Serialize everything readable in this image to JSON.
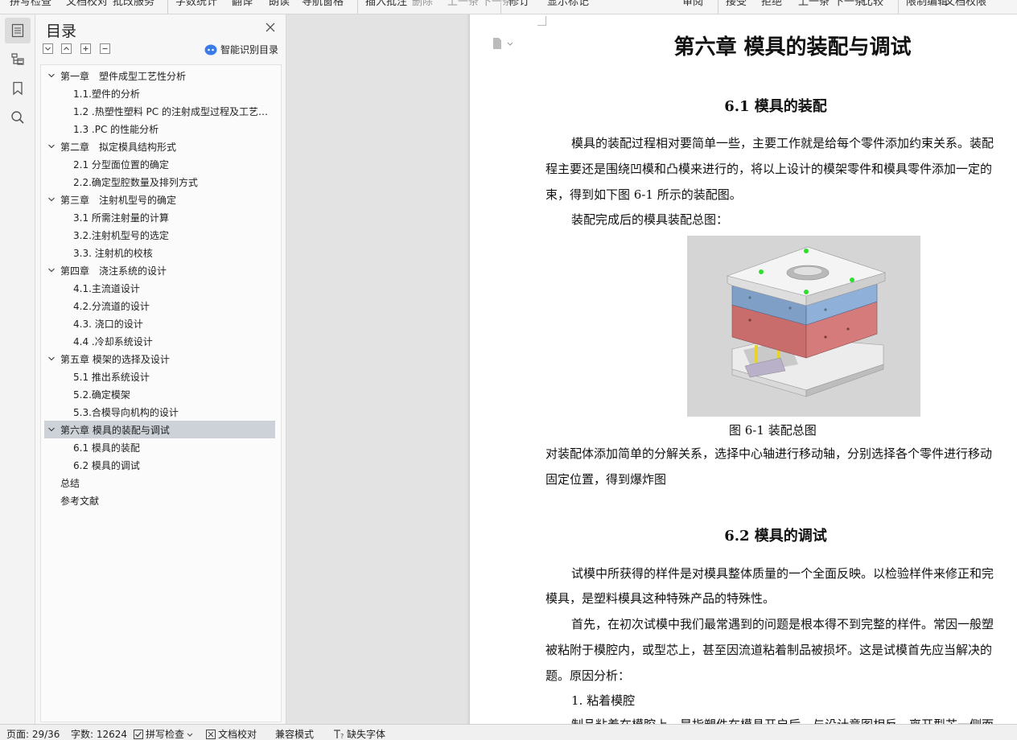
{
  "ribbon": {
    "items": [
      "拼写检查",
      "文档校对",
      "批改服务",
      "字数统计",
      "翻译",
      "朗读",
      "导航窗格",
      "插入批注",
      "删除",
      "上一条",
      "下一条",
      "修订",
      "显示标记",
      "审阅",
      "接受",
      "拒绝",
      "上一条",
      "下一条",
      "比较",
      "限制编辑",
      "文档权限"
    ]
  },
  "toc": {
    "title": "目录",
    "smart_label": "智能识别目录",
    "items": [
      {
        "level": 1,
        "text": "第一章　塑件成型工艺性分析",
        "expanded": true
      },
      {
        "level": 2,
        "text": "1.1.塑件的分析"
      },
      {
        "level": 2,
        "text": "1.2 .热塑性塑料 PC 的注射成型过程及工艺参数"
      },
      {
        "level": 2,
        "text": "1.3 .PC 的性能分析"
      },
      {
        "level": 1,
        "text": "第二章　拟定模具结构形式",
        "expanded": true
      },
      {
        "level": 2,
        "text": "2.1 分型面位置的确定"
      },
      {
        "level": 2,
        "text": "2.2.确定型腔数量及排列方式"
      },
      {
        "level": 1,
        "text": "第三章　注射机型号的确定",
        "expanded": true
      },
      {
        "level": 2,
        "text": "3.1 所需注射量的计算"
      },
      {
        "level": 2,
        "text": "3.2.注射机型号的选定"
      },
      {
        "level": 2,
        "text": "3.3.  注射机的校核"
      },
      {
        "level": 1,
        "text": "第四章　浇注系统的设计",
        "expanded": true
      },
      {
        "level": 2,
        "text": "4.1.主流道设计"
      },
      {
        "level": 2,
        "text": "4.2.分流道的设计"
      },
      {
        "level": 2,
        "text": "4.3.  浇口的设计"
      },
      {
        "level": 2,
        "text": "4.4 .冷却系统设计"
      },
      {
        "level": 1,
        "text": "第五章  模架的选择及设计",
        "expanded": true
      },
      {
        "level": 2,
        "text": "5.1  推出系统设计"
      },
      {
        "level": 2,
        "text": "5.2.确定模架"
      },
      {
        "level": 2,
        "text": "5.3.合模导向机构的设计"
      },
      {
        "level": 1,
        "text": "第六章  模具的装配与调试",
        "expanded": true,
        "selected": true
      },
      {
        "level": 2,
        "text": "6.1  模具的装配"
      },
      {
        "level": 2,
        "text": "6.2  模具的调试"
      },
      {
        "level": 0,
        "text": "总结"
      },
      {
        "level": 0,
        "text": "参考文献"
      }
    ]
  },
  "doc": {
    "chapter_title": "第六章  模具的装配与调试",
    "s1_title": "6.1  模具的装配",
    "p1_l1": "模具的装配过程相对要简单一些，主要工作就是给每个零件添加约束关系。装配",
    "p1_l2": "程主要还是围绕凹模和凸模来进行的，将以上设计的模架零件和模具零件添加一定的",
    "p1_l3": "束，得到如下图 6-1 所示的装配图。",
    "p2": "装配完成后的模具装配总图：",
    "caption": "图 6-1 装配总图",
    "p3_l1": "对装配体添加简单的分解关系，选择中心轴进行移动轴，分别选择各个零件进行移动",
    "p3_l2": "固定位置，得到爆炸图",
    "s2_title": "6.2  模具的调试",
    "p4_l1": "试模中所获得的样件是对模具整体质量的一个全面反映。以检验样件来修正和完",
    "p4_l2": "模具，是塑料模具这种特殊产品的特殊性。",
    "p5_l1": "首先，在初次试模中我们最常遇到的问题是根本得不到完整的样件。常因一般塑",
    "p5_l2": "被粘附于模腔内，或型芯上，甚至因流道粘着制品被损坏。这是试模首先应当解决的",
    "p5_l3": "题。原因分析：",
    "p6": "1. 粘着模腔",
    "p7": "制品粘着在模腔上，是指塑件在模具开启后，与设计意图相反，离开型芯一侧而"
  },
  "status": {
    "page": "页面: 29/36",
    "words": "字数: 12624",
    "spell": "拼写检查",
    "proof": "文档校对",
    "compat": "兼容模式",
    "missing_font": "缺失字体"
  },
  "colors": {
    "selected": "#cdd2d8",
    "accent": "#3a7be8"
  }
}
